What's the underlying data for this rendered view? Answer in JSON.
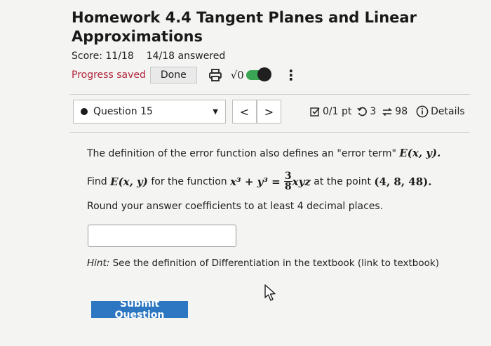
{
  "header": {
    "title": "Homework 4.4 Tangent Planes and Linear Approximations",
    "score": "Score: 11/18",
    "answered": "14/18 answered",
    "progress": "Progress saved",
    "done_label": "Done",
    "sqrt_label": "√0",
    "kebab": "⋮"
  },
  "question_bar": {
    "selector_label": "Question 15",
    "prev": "<",
    "next": ">",
    "points": "0/1 pt",
    "retries": "3",
    "attempts": "98",
    "details": "Details"
  },
  "question": {
    "line1_text": "The definition of the error function also defines an \"error term\" ",
    "line1_math": "E(x, y).",
    "line2_a": "Find ",
    "line2_math1": "E(x, y)",
    "line2_b": " for the function ",
    "line2_math2": "x³ + y³ = ",
    "frac_num": "3",
    "frac_den": "8",
    "line2_math3": "xyz",
    "line2_c": " at the point ",
    "line2_point": "(4, 8, 48).",
    "line3": "Round your answer coefficients to at least 4 decimal places.",
    "answer_value": ""
  },
  "hint": {
    "label": "Hint:",
    "text": " See the definition of Differentiation in the textbook (link to textbook)"
  },
  "submit_label": "Submit Question"
}
